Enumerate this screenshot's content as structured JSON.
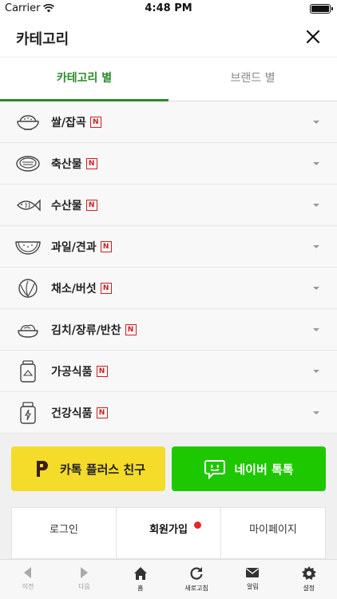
{
  "status_bar": {
    "carrier": "Carrier",
    "time": "4:48 PM"
  },
  "header": {
    "title": "카테고리"
  },
  "tabs": [
    {
      "label": "카테고리 별",
      "active": true
    },
    {
      "label": "브랜드 별",
      "active": false
    }
  ],
  "categories": [
    {
      "label": "쌀/잡곡",
      "badge": "N",
      "icon": "rice-bowl-icon"
    },
    {
      "label": "축산물",
      "badge": "N",
      "icon": "steak-icon"
    },
    {
      "label": "수산물",
      "badge": "N",
      "icon": "fish-icon"
    },
    {
      "label": "과일/견과",
      "badge": "N",
      "icon": "watermelon-icon"
    },
    {
      "label": "채소/버섯",
      "badge": "N",
      "icon": "cabbage-icon"
    },
    {
      "label": "김치/장류/반찬",
      "badge": "N",
      "icon": "side-dish-icon"
    },
    {
      "label": "가공식품",
      "badge": "N",
      "icon": "jar-icon"
    },
    {
      "label": "건강식품",
      "badge": "N",
      "icon": "supplement-bottle-icon"
    }
  ],
  "promos": {
    "kakao": {
      "label": "카톡 플러스 친구",
      "icon": "kakao-plus-icon",
      "color": "#f5dc2a"
    },
    "naver": {
      "label": "네이버 톡톡",
      "icon": "naver-talk-icon",
      "color": "#1ec800"
    }
  },
  "auth": {
    "login": "로그인",
    "signup": "회원가입",
    "mypage": "마이페이지"
  },
  "toolbar": [
    {
      "label": "이전",
      "icon": "back-arrow-icon"
    },
    {
      "label": "다음",
      "icon": "forward-arrow-icon"
    },
    {
      "label": "홈",
      "icon": "home-icon"
    },
    {
      "label": "새로고침",
      "icon": "refresh-icon"
    },
    {
      "label": "알림",
      "icon": "mail-icon"
    },
    {
      "label": "설정",
      "icon": "gear-icon"
    }
  ],
  "colors": {
    "accent": "#2a8a2a",
    "badge": "#d21e1e"
  }
}
